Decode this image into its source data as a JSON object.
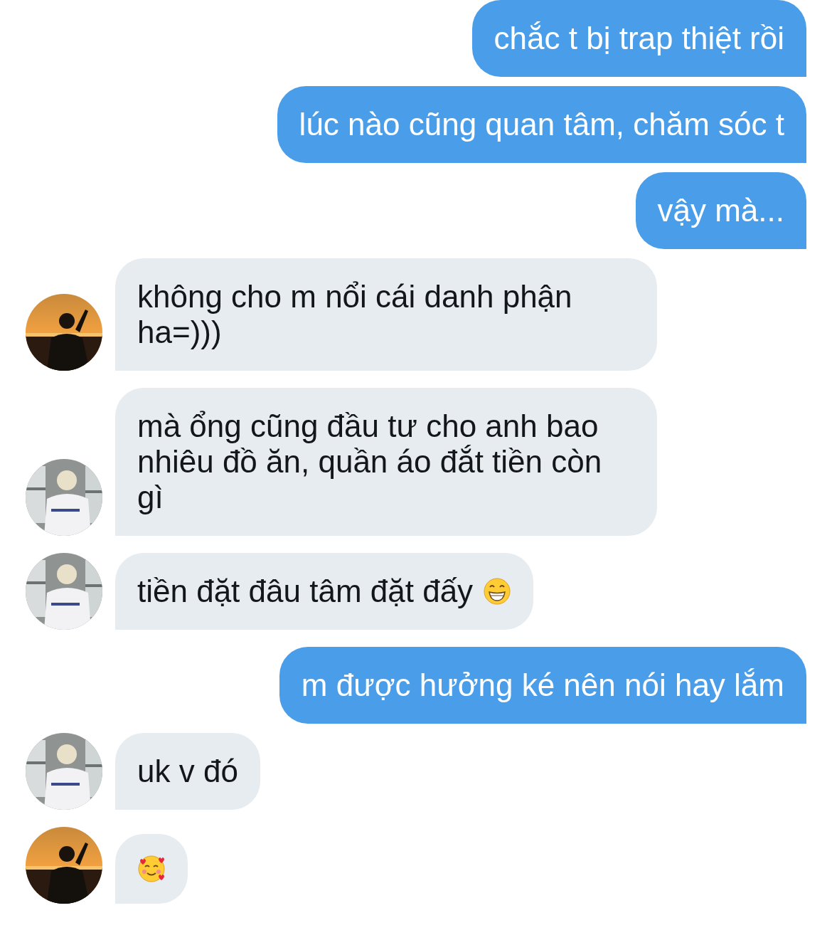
{
  "messages": [
    {
      "kind": "outgoing",
      "text": "chắc t bị trap thiệt rồi"
    },
    {
      "kind": "outgoing",
      "text": "lúc nào cũng quan tâm, chăm sóc t"
    },
    {
      "kind": "outgoing",
      "text": "vậy mà..."
    },
    {
      "kind": "incoming",
      "text": "không cho m nổi cái danh phận ha=)))"
    },
    {
      "kind": "incoming",
      "text": "mà ổng cũng đầu tư cho anh bao nhiêu đồ ăn, quần áo đắt tiền còn gì"
    },
    {
      "kind": "incoming",
      "text": "tiền đặt đâu tâm đặt đấy",
      "emoji": {
        "kind": "grin"
      }
    },
    {
      "kind": "outgoing",
      "text": "m được hưởng ké nên nói hay lắm"
    },
    {
      "kind": "incoming",
      "text": "uk v đó"
    },
    {
      "kind": "incoming",
      "emoji": {
        "kind": "hearts"
      }
    }
  ]
}
